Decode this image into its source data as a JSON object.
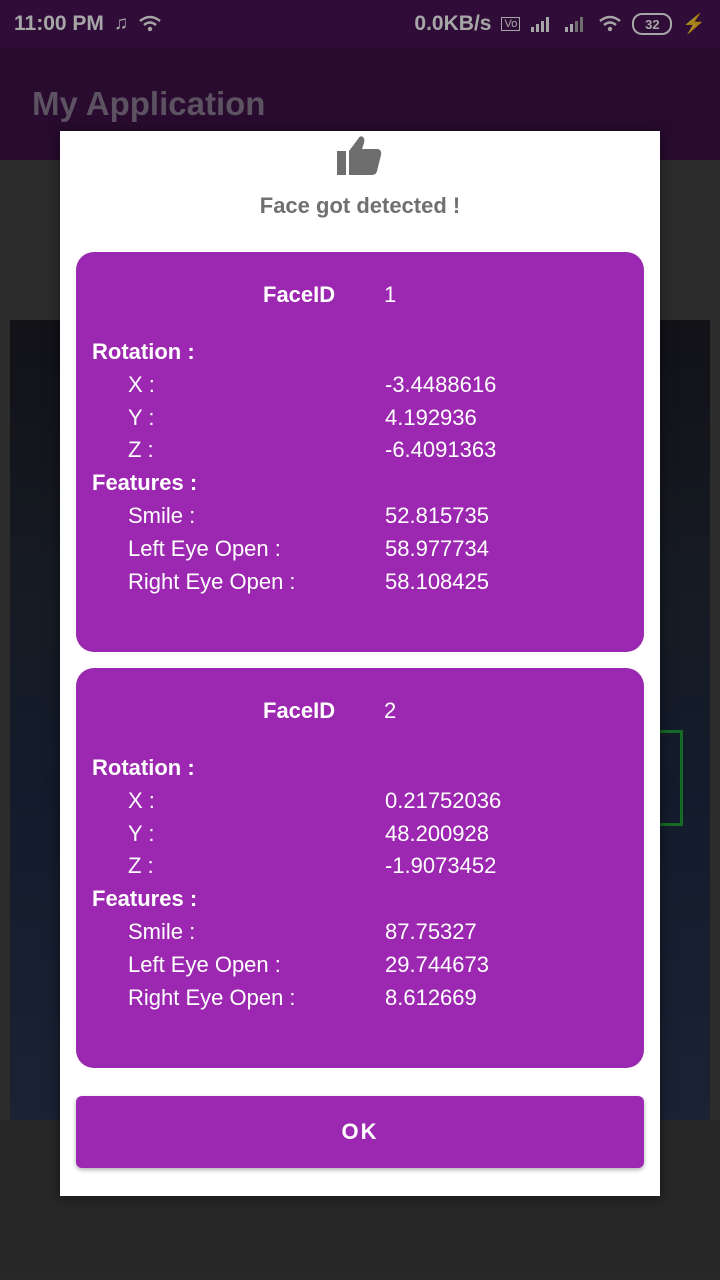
{
  "status_bar": {
    "time": "11:00 PM",
    "speed": "0.0KB/s",
    "battery": "32",
    "icons": [
      "music-icon",
      "wifi-icon",
      "volte-icon",
      "signal-icon",
      "battery-icon",
      "charging-icon"
    ]
  },
  "app_bar": {
    "title": "My Application"
  },
  "dialog": {
    "icon": "thumbs-up-icon",
    "title": "Face got detected !",
    "ok_label": "OK",
    "faces": [
      {
        "faceid_label": "FaceID",
        "faceid": "1",
        "rotation_label": "Rotation :",
        "x_label": "X :",
        "x": "-3.4488616",
        "y_label": "Y :",
        "y": "4.192936",
        "z_label": "Z :",
        "z": "-6.4091363",
        "features_label": "Features :",
        "smile_label": "Smile :",
        "smile": "52.815735",
        "left_eye_label": "Left Eye Open :",
        "left_eye": "58.977734",
        "right_eye_label": "Right Eye Open :",
        "right_eye": "58.108425"
      },
      {
        "faceid_label": "FaceID",
        "faceid": "2",
        "rotation_label": "Rotation :",
        "x_label": "X :",
        "x": "0.21752036",
        "y_label": "Y :",
        "y": "48.200928",
        "z_label": "Z :",
        "z": "-1.9073452",
        "features_label": "Features :",
        "smile_label": "Smile :",
        "smile": "87.75327",
        "left_eye_label": "Left Eye Open :",
        "left_eye": "29.744673",
        "right_eye_label": "Right Eye Open :",
        "right_eye": "8.612669"
      }
    ]
  },
  "colors": {
    "card": "#9c27b0",
    "app_bar": "#3e1247",
    "status_bar": "#4a1456"
  }
}
